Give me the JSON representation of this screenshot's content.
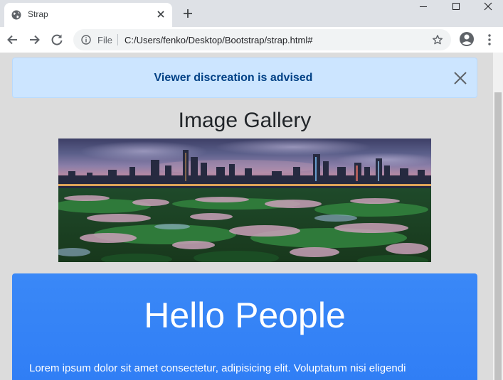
{
  "browser": {
    "tab_title": "Strap",
    "scheme_label": "File",
    "url": "C:/Users/fenko/Desktop/Bootstrap/strap.html#"
  },
  "page": {
    "alert_text": "Viewer discreation is advised",
    "gallery_title": "Image Gallery",
    "jumbotron_title": "Hello People",
    "jumbotron_text": "Lorem ipsum dolor sit amet consectetur, adipisicing elit. Voluptatum nisi eligendi"
  },
  "colors": {
    "alert_bg": "#cce5ff",
    "alert_text": "#004085",
    "jumbotron_bg": "#3a88f7"
  },
  "icons": {
    "favicon": "globe-icon",
    "tab_close": "close-icon",
    "new_tab": "plus-icon",
    "back": "arrow-left-icon",
    "forward": "arrow-right-icon",
    "reload": "reload-icon",
    "info": "info-icon",
    "bookmark": "star-icon",
    "account": "account-icon",
    "menu": "kebab-menu-icon",
    "alert_close": "close-icon"
  }
}
